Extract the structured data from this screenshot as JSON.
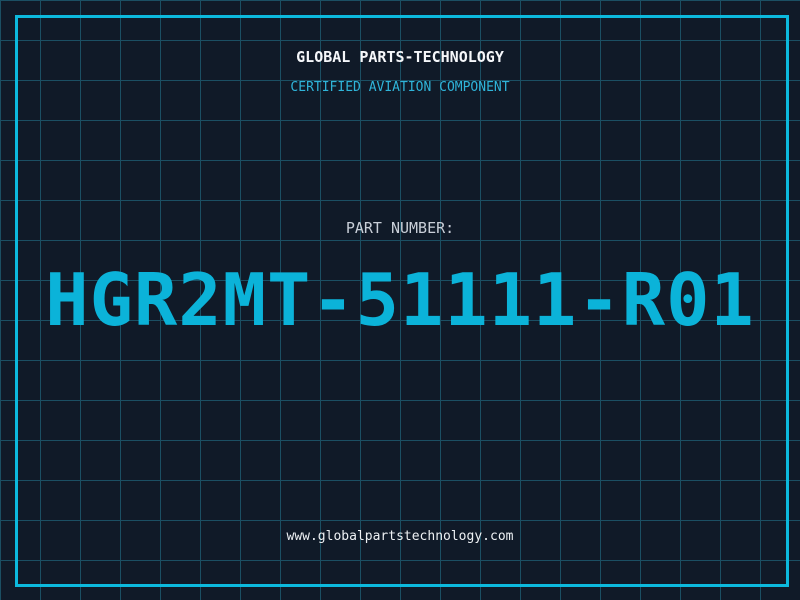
{
  "header": {
    "title": "GLOBAL PARTS-TECHNOLOGY",
    "subtitle": "CERTIFIED AVIATION COMPONENT"
  },
  "part": {
    "label": "PART NUMBER:",
    "number": "HGR2MT-51111-R01"
  },
  "footer": {
    "url": "www.globalpartstechnology.com"
  },
  "colors": {
    "bg": "#101a28",
    "grid": "#1b4f63",
    "frame": "#0cb9dd",
    "title": "#f5f7fa",
    "subtitle": "#2fb4d9",
    "label": "#c9cfd8",
    "number": "#0bb3d9",
    "url": "#eef1f4"
  }
}
